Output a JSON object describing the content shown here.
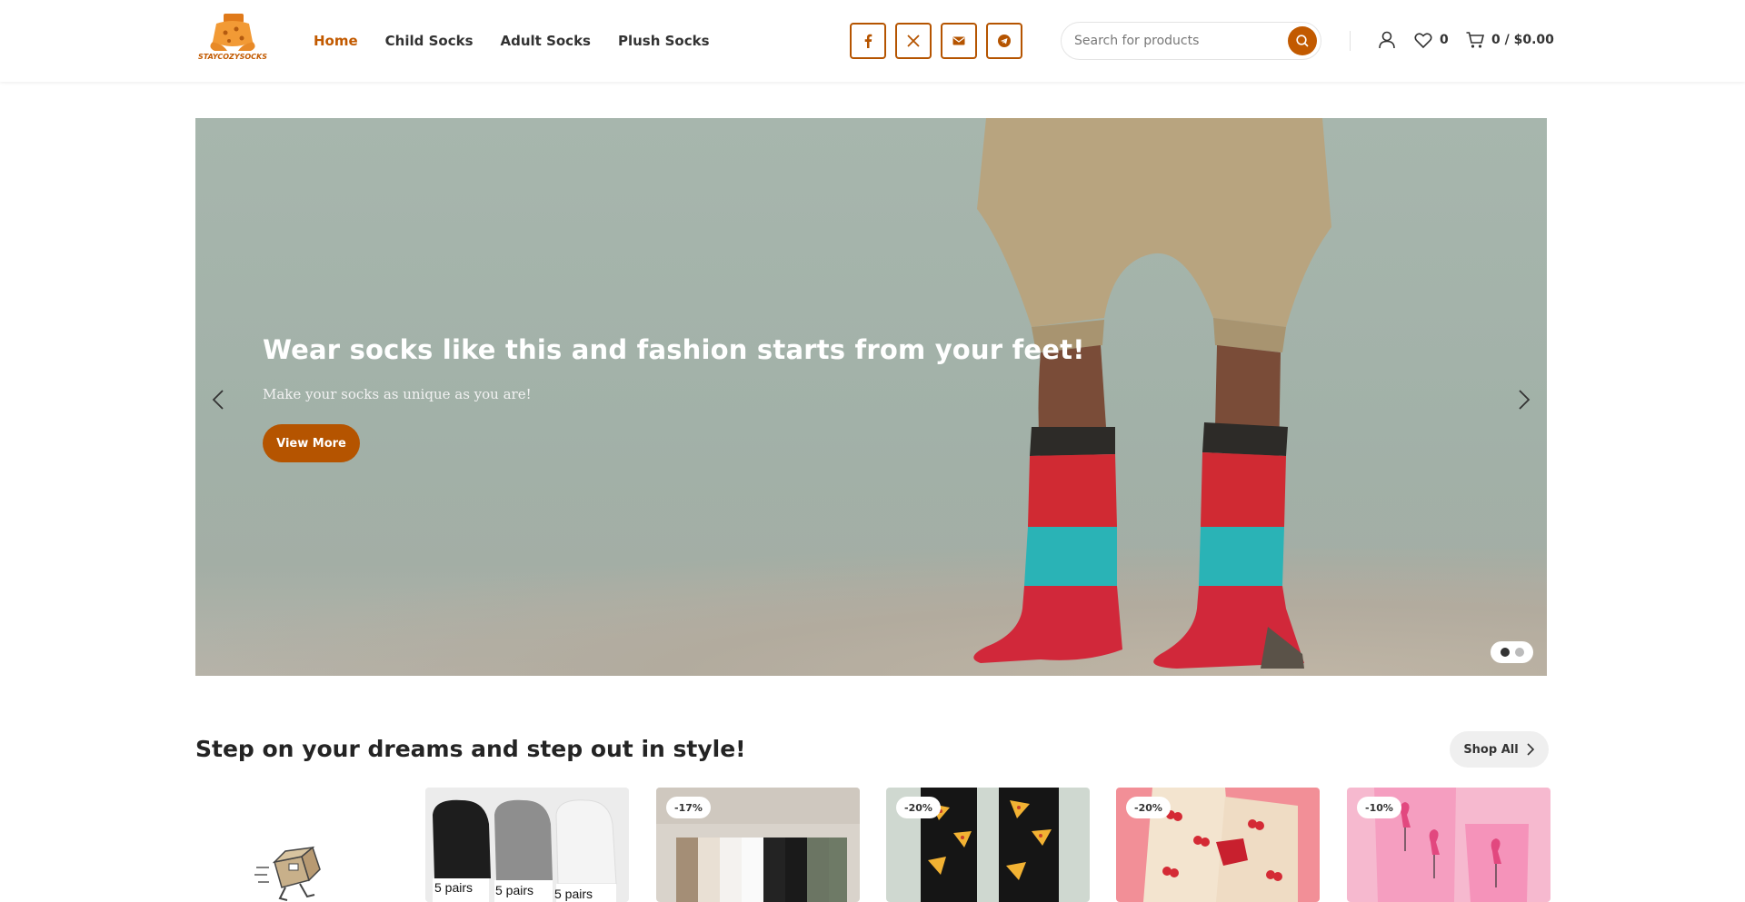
{
  "brand": {
    "logo_text": "STAYCOZYSOCKS",
    "accent": "#c25a00"
  },
  "nav": {
    "items": [
      {
        "label": "Home",
        "active": true
      },
      {
        "label": "Child Socks",
        "active": false
      },
      {
        "label": "Adult Socks",
        "active": false
      },
      {
        "label": "Plush Socks",
        "active": false
      }
    ]
  },
  "socials": [
    "facebook-icon",
    "x-icon",
    "email-icon",
    "telegram-icon"
  ],
  "search": {
    "placeholder": "Search for products"
  },
  "header": {
    "wishlist_count": "0",
    "cart_summary": "0 / $0.00"
  },
  "hero": {
    "title": "Wear socks like this and fashion starts from your feet!",
    "subtitle": "Make your socks as unique as you are!",
    "button": "View More",
    "slides_total": 2,
    "active_slide": 1
  },
  "section": {
    "title": "Step on your dreams and step out in style!",
    "shop_all": "Shop All"
  },
  "products": [
    {
      "badge": "",
      "image_text": [
        "5 pairs",
        "5 pairs",
        "5 pairs"
      ]
    },
    {
      "badge": "-17%"
    },
    {
      "badge": "-20%"
    },
    {
      "badge": "-20%"
    },
    {
      "badge": "-10%"
    }
  ]
}
